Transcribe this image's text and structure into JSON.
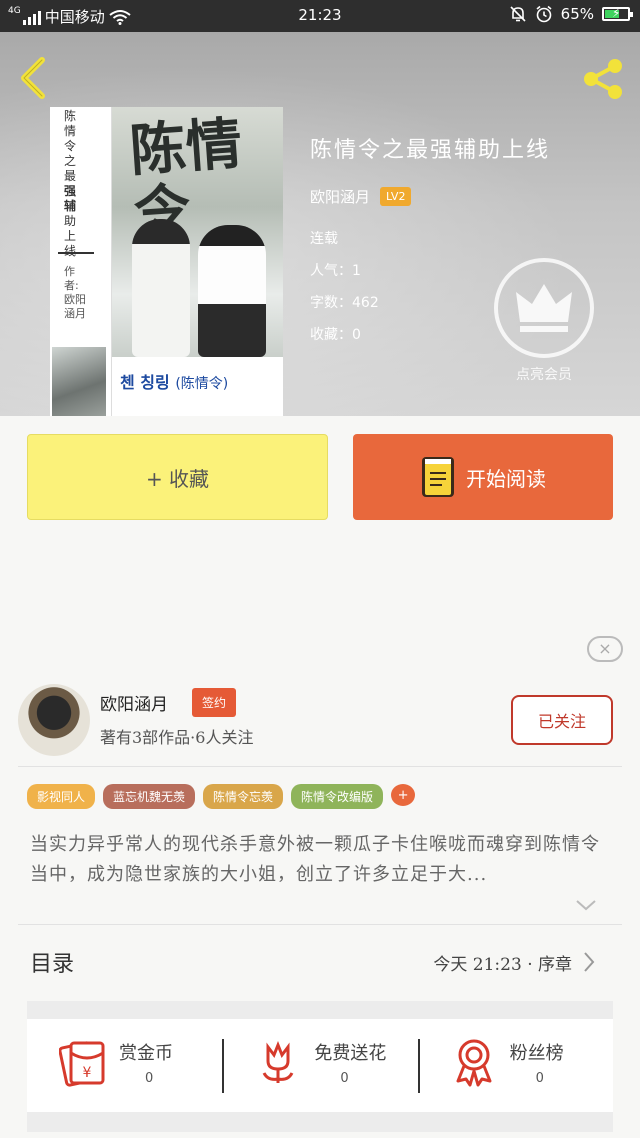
{
  "status_bar": {
    "network": "4G",
    "carrier": "中国移动",
    "time": "21:23",
    "battery": "65%",
    "battery_level": 0.65
  },
  "book": {
    "title": "陈情令之最强辅助上线",
    "author": "欧阳涵月",
    "level": "LV2",
    "status": "连载",
    "popularity": "人气：1",
    "word_count": "字数：462",
    "favorites": "收藏：0"
  },
  "cover": {
    "vertical_title_chars": [
      "陈",
      "情",
      "令",
      "之",
      "最",
      "强",
      "辅",
      "助",
      "上",
      "线"
    ],
    "vertical_author": "作者:欧阳涵月",
    "art_text": "陈情令",
    "caption_korean": "첸 칭링",
    "caption_chinese": "(陈情令)"
  },
  "vip": {
    "label": "点亮会员"
  },
  "buttons": {
    "collect": "+ 收藏",
    "read": "开始阅读"
  },
  "ad_close": "×",
  "author_card": {
    "name": "欧阳涵月",
    "badge": "签约",
    "stats": "著有3部作品·6人关注",
    "follow": "已关注"
  },
  "tags": [
    {
      "label": "影视同人",
      "color": "#f0b24a"
    },
    {
      "label": "蓝忘机魏无羡",
      "color": "#b86e5c"
    },
    {
      "label": "陈情令忘羡",
      "color": "#d9a64a"
    },
    {
      "label": "陈情令改编版",
      "color": "#8fb45a"
    }
  ],
  "tag_more": "+",
  "synopsis": "当实力异乎常人的现代杀手意外被一颗瓜子卡住喉咙而魂穿到陈情令当中，成为隐世家族的大小姐，创立了许多立足于大...",
  "toc": {
    "label": "目录",
    "update": "今天 21:23 · 序章"
  },
  "actions": [
    {
      "label": "赏金币",
      "count": "0",
      "icon": "red-envelope-icon"
    },
    {
      "label": "免费送花",
      "count": "0",
      "icon": "flower-icon"
    },
    {
      "label": "粉丝榜",
      "count": "0",
      "icon": "medal-icon"
    }
  ]
}
